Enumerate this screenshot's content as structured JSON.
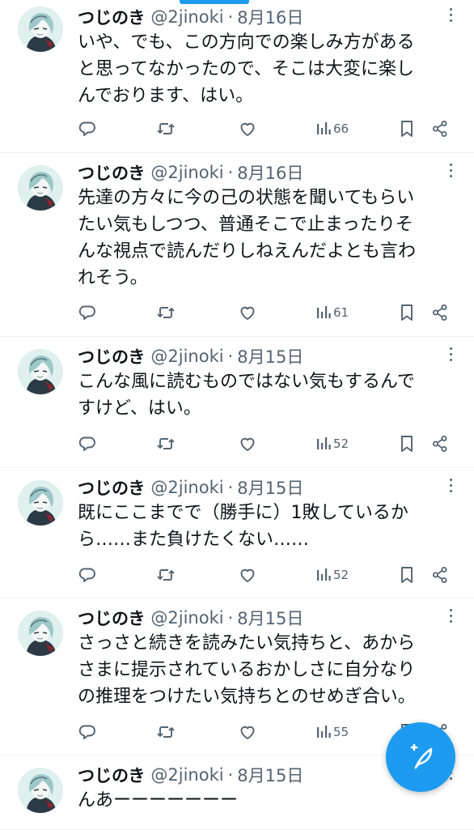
{
  "accent_color": "#1d9bf0",
  "tweets": [
    {
      "name": "つじのき",
      "handle": "@2jinoki",
      "separator": "·",
      "date": "8月16日",
      "lines": [
        "いや、でも、この方向での楽しみ方がある",
        "と思ってなかったので、そこは大変に楽し",
        "んでおります、はい。"
      ],
      "views": "66"
    },
    {
      "name": "つじのき",
      "handle": "@2jinoki",
      "separator": "·",
      "date": "8月16日",
      "lines": [
        "先達の方々に今の己の状態を聞いてもらい",
        "たい気もしつつ、普通そこで止まったりそ",
        "んな視点で読んだりしねえんだよとも言わ",
        "れそう。"
      ],
      "views": "61"
    },
    {
      "name": "つじのき",
      "handle": "@2jinoki",
      "separator": "·",
      "date": "8月15日",
      "lines": [
        "こんな風に読むものではない気もするんで",
        "すけど、はい。"
      ],
      "views": "52"
    },
    {
      "name": "つじのき",
      "handle": "@2jinoki",
      "separator": "·",
      "date": "8月15日",
      "lines": [
        "既にここまでで（勝手に）1敗しているか",
        "ら……また負けたくない……"
      ],
      "views": "52"
    },
    {
      "name": "つじのき",
      "handle": "@2jinoki",
      "separator": "·",
      "date": "8月15日",
      "lines": [
        "さっさと続きを読みたい気持ちと、あから",
        "さまに提示されているおかしさに自分なり",
        "の推理をつけたい気持ちとのせめぎ合い。"
      ],
      "views": "55"
    },
    {
      "name": "つじのき",
      "handle": "@2jinoki",
      "separator": "·",
      "date": "8月15日",
      "lines": [
        "んあーーーーーーー"
      ],
      "views": ""
    }
  ],
  "icons": {
    "reply": "reply-icon",
    "retweet": "retweet-icon",
    "like": "like-icon",
    "views": "views-icon",
    "bookmark": "bookmark-icon",
    "share": "share-icon",
    "compose": "compose-feather-icon"
  }
}
